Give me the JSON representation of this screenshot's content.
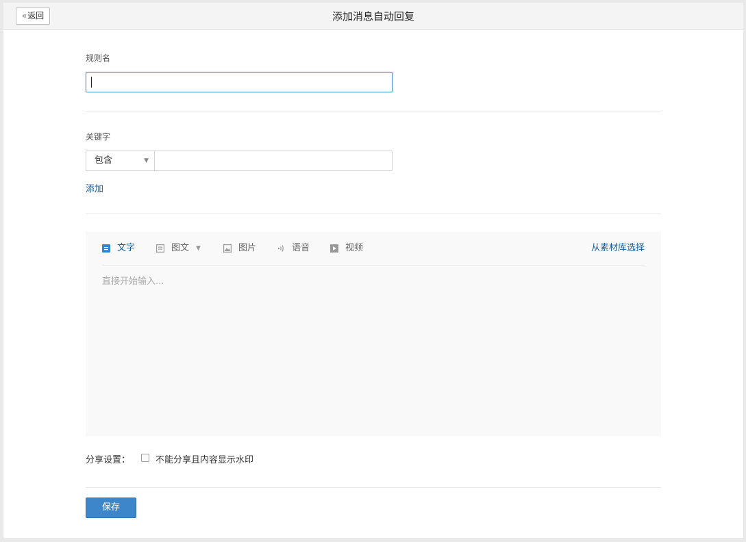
{
  "header": {
    "back_label": "返回",
    "title": "添加消息自动回复"
  },
  "rule": {
    "label": "规则名",
    "value": ""
  },
  "keyword": {
    "label": "关键字",
    "match_mode": "包含",
    "value": "",
    "add_label": "添加"
  },
  "editor": {
    "tabs": [
      {
        "label": "文字",
        "icon": "text-icon",
        "active": true
      },
      {
        "label": "图文",
        "icon": "news-icon",
        "active": false
      },
      {
        "label": "图片",
        "icon": "image-icon",
        "active": false
      },
      {
        "label": "语音",
        "icon": "voice-icon",
        "active": false
      },
      {
        "label": "视频",
        "icon": "video-icon",
        "active": false
      }
    ],
    "library_label": "从素材库选择",
    "placeholder": "直接开始输入..."
  },
  "share": {
    "label": "分享设置：",
    "option_label": "不能分享且内容显示水印",
    "checked": false
  },
  "actions": {
    "save_label": "保存"
  },
  "colors": {
    "accent": "#1a5b97",
    "button": "#3d86c9",
    "input_focus": "#4c8ec9"
  }
}
